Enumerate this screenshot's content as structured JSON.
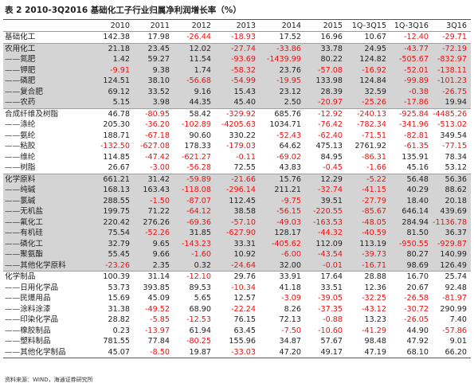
{
  "title": "表 2  2010-3Q2016 基础化工子行业归属净利润增长率（%）",
  "table": {
    "columns": [
      "",
      "2010",
      "2011",
      "2012",
      "2013",
      "2014",
      "2015",
      "1Q-3Q15",
      "1Q-3Q16",
      "3Q16"
    ],
    "rows": [
      {
        "label": "基础化工",
        "values": [
          "142.38",
          "17.98",
          "-26.44",
          "-18.93",
          "17.52",
          "16.96",
          "10.67",
          "-12.40",
          "-29.71"
        ],
        "shaded": false,
        "section": false
      },
      {
        "label": "农用化工",
        "values": [
          "21.18",
          "23.45",
          "12.02",
          "-27.74",
          "-33.86",
          "33.78",
          "24.95",
          "-43.77",
          "-72.19"
        ],
        "shaded": true,
        "section": true
      },
      {
        "label": "——氮肥",
        "values": [
          "1.42",
          "59.27",
          "11.54",
          "-93.69",
          "-1439.99",
          "80.22",
          "124.82",
          "-505.67",
          "-832.97"
        ],
        "shaded": true,
        "section": false
      },
      {
        "label": "——钾肥",
        "values": [
          "-9.91",
          "9.38",
          "1.74",
          "-58.32",
          "23.76",
          "-57.08",
          "-16.92",
          "-52.01",
          "-138.11"
        ],
        "shaded": true,
        "section": false
      },
      {
        "label": "——磷肥",
        "values": [
          "124.51",
          "38.10",
          "-56.68",
          "-54.99",
          "-19.95",
          "133.98",
          "124.84",
          "-99.89",
          "-101.23"
        ],
        "shaded": true,
        "section": false
      },
      {
        "label": "——复合肥",
        "values": [
          "69.12",
          "33.52",
          "9.16",
          "15.43",
          "23.12",
          "28.39",
          "32.59",
          "-0.38",
          "-26.75"
        ],
        "shaded": true,
        "section": false
      },
      {
        "label": "——农药",
        "values": [
          "5.15",
          "3.98",
          "44.35",
          "45.40",
          "2.50",
          "-20.97",
          "-25.26",
          "-17.86",
          "19.94"
        ],
        "shaded": true,
        "section": false
      },
      {
        "label": "合成纤维及树脂",
        "values": [
          "46.78",
          "-80.95",
          "58.42",
          "-329.92",
          "685.76",
          "-12.92",
          "-240.13",
          "-925.84",
          "-4485.26"
        ],
        "shaded": false,
        "section": true
      },
      {
        "label": "——涤纶",
        "values": [
          "205.30",
          "-36.20",
          "-102.89",
          "-4205.63",
          "1034.71",
          "-76.42",
          "-782.34",
          "-341.96",
          "-513.02"
        ],
        "shaded": false,
        "section": false
      },
      {
        "label": "——氨纶",
        "values": [
          "188.71",
          "-67.18",
          "90.60",
          "330.22",
          "-52.43",
          "-62.40",
          "-71.51",
          "-82.81",
          "349.54"
        ],
        "shaded": false,
        "section": false
      },
      {
        "label": "——粘胶",
        "values": [
          "-132.50",
          "-627.08",
          "178.33",
          "-179.03",
          "64.62",
          "475.13",
          "2761.92",
          "-61.35",
          "-77.15"
        ],
        "shaded": false,
        "section": false
      },
      {
        "label": "——维纶",
        "values": [
          "114.85",
          "-47.42",
          "-621.27",
          "-0.11",
          "-69.02",
          "84.95",
          "-86.31",
          "135.91",
          "78.34"
        ],
        "shaded": false,
        "section": false
      },
      {
        "label": "——树脂",
        "values": [
          "26.67",
          "-3.00",
          "-56.28",
          "72.55",
          "43.83",
          "-0.45",
          "-1.66",
          "45.16",
          "53.12"
        ],
        "shaded": false,
        "section": false
      },
      {
        "label": "化学原料",
        "values": [
          "661.21",
          "31.42",
          "-59.89",
          "-21.66",
          "15.76",
          "12.29",
          "-5.22",
          "56.48",
          "56.36"
        ],
        "shaded": true,
        "section": true
      },
      {
        "label": "——纯碱",
        "values": [
          "168.13",
          "163.43",
          "-118.08",
          "-296.14",
          "211.21",
          "-32.74",
          "-41.15",
          "40.29",
          "88.62"
        ],
        "shaded": true,
        "section": false
      },
      {
        "label": "——氯碱",
        "values": [
          "288.55",
          "-1.50",
          "-87.07",
          "112.45",
          "-9.75",
          "39.51",
          "-27.79",
          "18.40",
          "20.18"
        ],
        "shaded": true,
        "section": false
      },
      {
        "label": "——无机盐",
        "values": [
          "199.75",
          "71.22",
          "-64.12",
          "38.58",
          "-56.15",
          "-220.55",
          "-85.67",
          "646.14",
          "439.69"
        ],
        "shaded": true,
        "section": false
      },
      {
        "label": "——氟化工",
        "values": [
          "220.42",
          "276.26",
          "-69.36",
          "-57.10",
          "-49.03",
          "-163.53",
          "-48.05",
          "284.94",
          "-1136.78"
        ],
        "shaded": true,
        "section": false
      },
      {
        "label": "——有机硅",
        "values": [
          "75.54",
          "-52.26",
          "31.85",
          "-627.90",
          "128.17",
          "-44.32",
          "-40.59",
          "81.50",
          "36.37"
        ],
        "shaded": true,
        "section": false
      },
      {
        "label": "——磷化工",
        "values": [
          "32.79",
          "9.65",
          "-143.23",
          "33.31",
          "-405.62",
          "112.09",
          "113.19",
          "-950.55",
          "-929.87"
        ],
        "shaded": true,
        "section": false
      },
      {
        "label": "——聚氨酯",
        "values": [
          "55.45",
          "9.66",
          "-1.60",
          "10.92",
          "-6.00",
          "-43.54",
          "-39.73",
          "80.27",
          "140.99"
        ],
        "shaded": true,
        "section": false
      },
      {
        "label": "——其他化学原料",
        "values": [
          "-23.26",
          "2.35",
          "0.32",
          "-24.64",
          "32.00",
          "-0.01",
          "-16.71",
          "98.69",
          "126.49"
        ],
        "shaded": true,
        "section": false
      },
      {
        "label": "化学制品",
        "values": [
          "100.39",
          "31.14",
          "-12.10",
          "29.76",
          "33.91",
          "17.64",
          "28.88",
          "16.70",
          "25.74"
        ],
        "shaded": false,
        "section": true
      },
      {
        "label": "——日用化学品",
        "values": [
          "53.73",
          "393.85",
          "89.53",
          "-10.34",
          "41.18",
          "33.51",
          "12.36",
          "20.67",
          "92.48"
        ],
        "shaded": false,
        "section": false
      },
      {
        "label": "——民爆用品",
        "values": [
          "15.69",
          "45.09",
          "5.65",
          "12.57",
          "-3.09",
          "-39.05",
          "-32.25",
          "-26.58",
          "-81.97"
        ],
        "shaded": false,
        "section": false
      },
      {
        "label": "——涂料涂漆",
        "values": [
          "31.38",
          "-49.52",
          "68.90",
          "-22.24",
          "8.26",
          "-37.35",
          "-43.12",
          "-30.72",
          "290.99"
        ],
        "shaded": false,
        "section": false
      },
      {
        "label": "——印染化学品",
        "values": [
          "28.82",
          "-5.85",
          "-12.53",
          "76.15",
          "72.13",
          "-0.88",
          "13.23",
          "-26.05",
          "7.40"
        ],
        "shaded": false,
        "section": false
      },
      {
        "label": "——橡胶制品",
        "values": [
          "0.23",
          "-13.97",
          "61.94",
          "63.45",
          "-7.50",
          "-10.60",
          "-41.29",
          "44.90",
          "-57.86"
        ],
        "shaded": false,
        "section": false
      },
      {
        "label": "——塑料制品",
        "values": [
          "781.55",
          "77.84",
          "-80.25",
          "155.96",
          "34.87",
          "57.67",
          "98.48",
          "47.92",
          "9.01"
        ],
        "shaded": false,
        "section": false
      },
      {
        "label": "——其他化学制品",
        "values": [
          "45.07",
          "-8.50",
          "19.87",
          "-33.03",
          "47.20",
          "49.17",
          "47.19",
          "68.10",
          "66.20"
        ],
        "shaded": false,
        "section": false
      }
    ]
  },
  "footnote": "资料来源：WIND，海通证券研究所",
  "colors": {
    "negative": "#ee1111",
    "shaded": "#d4d4d4"
  }
}
